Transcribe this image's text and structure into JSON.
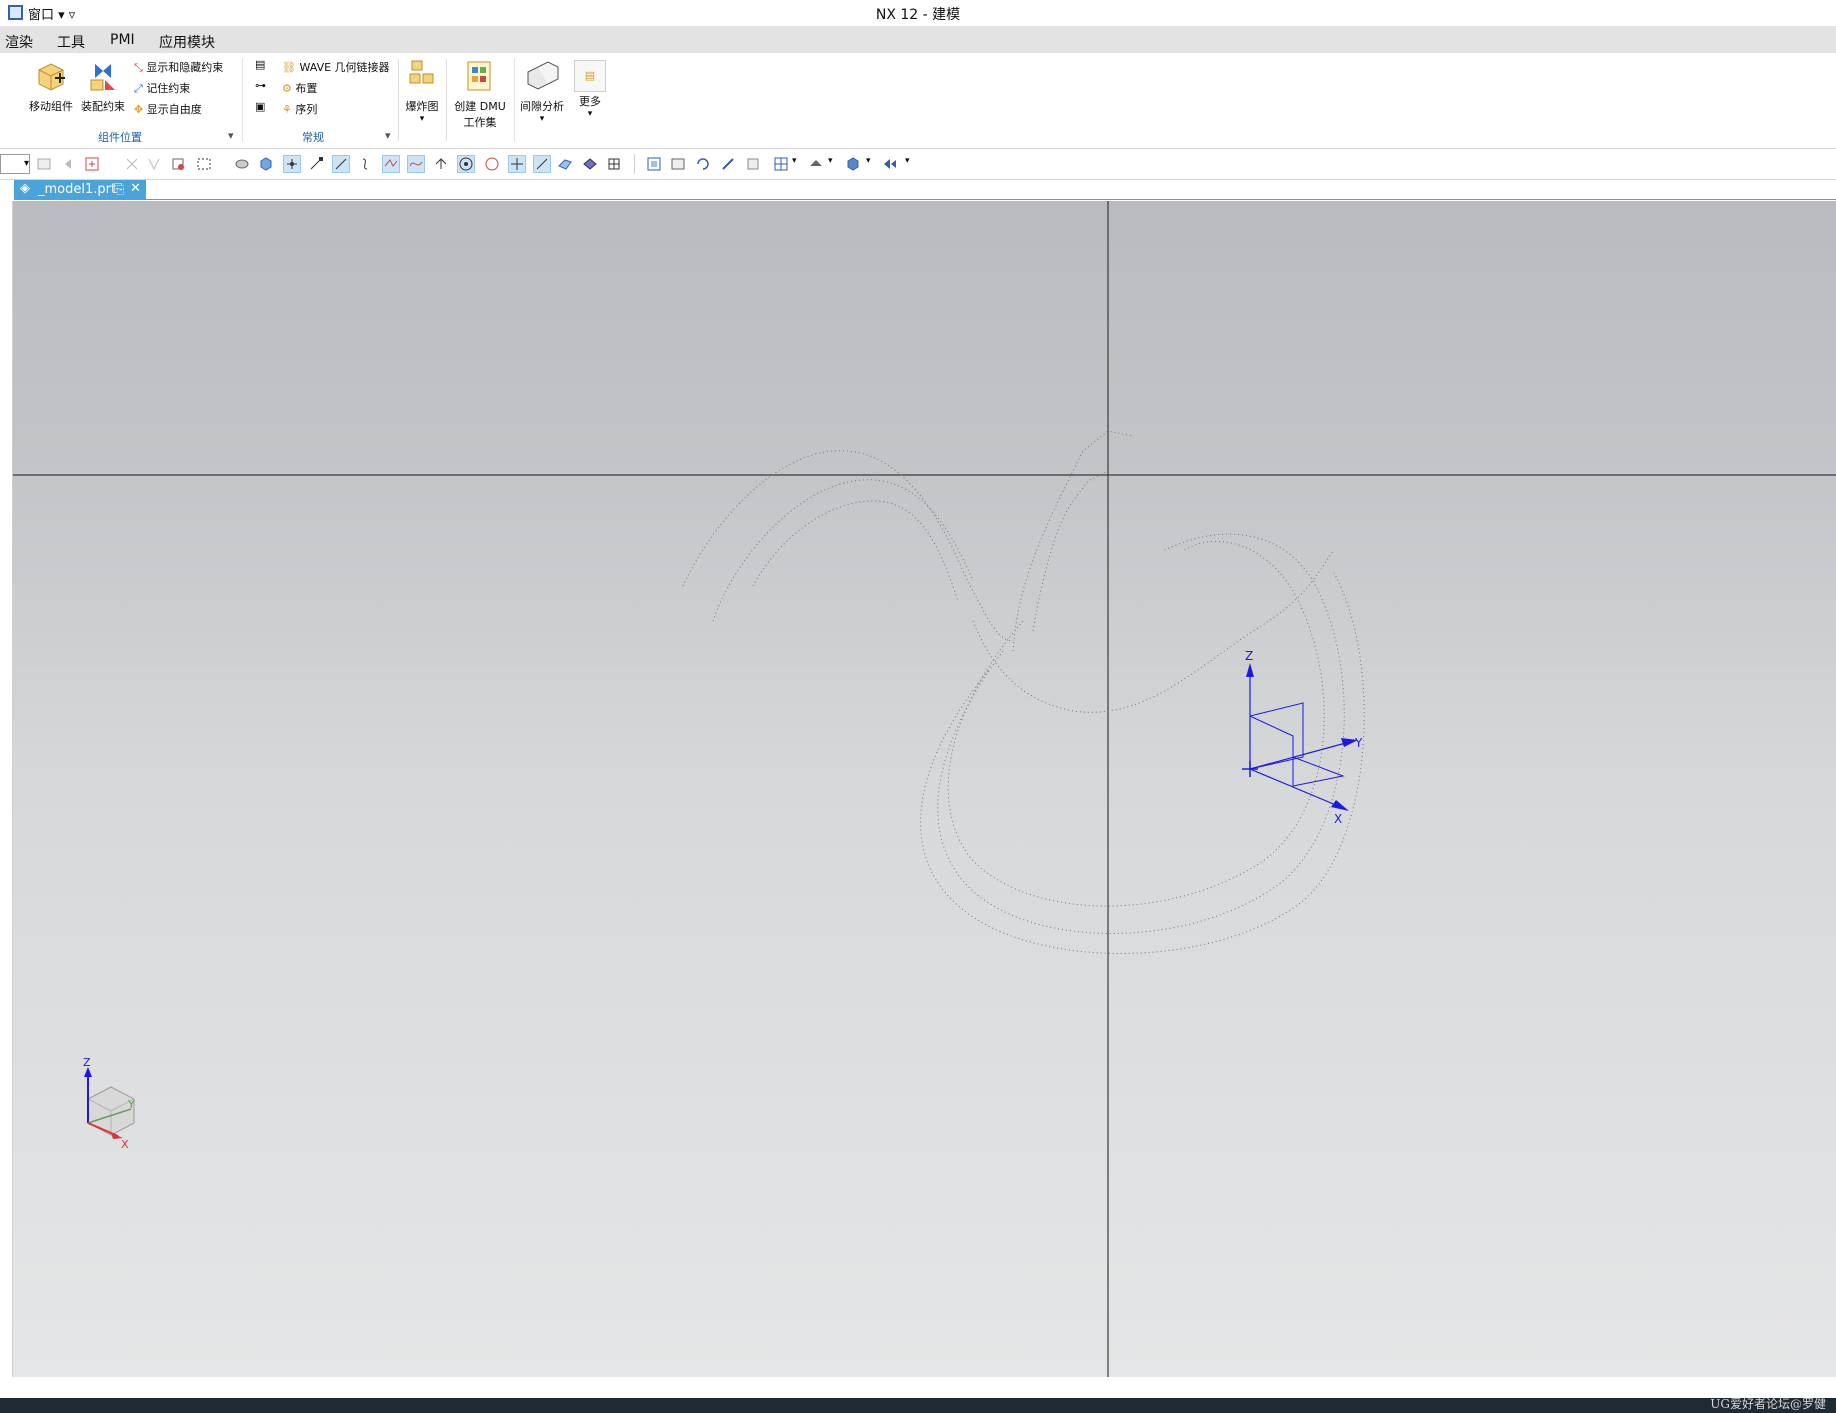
{
  "window": {
    "menu_label": "窗口 ▾ ▿",
    "title": "NX 12 - 建模"
  },
  "menubar": {
    "items": [
      "渲染",
      "工具",
      "PMI",
      "应用模块"
    ]
  },
  "ribbon": {
    "move_component": "移动组件",
    "assembly_constraint": "装配约束",
    "show_hide_constraints": "显示和隐藏约束",
    "remember_constraints": "记住约束",
    "show_dof": "显示自由度",
    "group_component_position": "组件位置",
    "wave_linker": "WAVE 几何链接器",
    "arrangement": "布置",
    "sequence": "序列",
    "group_general": "常规",
    "exploded_view": "爆炸图",
    "create_dmu_line1": "创建 DMU",
    "create_dmu_line2": "工作集",
    "clearance_analysis": "间隙分析",
    "more": "更多"
  },
  "tab": {
    "filename": "_model1.prt"
  },
  "triad": {
    "z": "Z",
    "y": "Y",
    "x": "X"
  },
  "mini_triad": {
    "z": "Z",
    "y": "Y",
    "x": "X"
  },
  "watermark": "UG爱好者论坛@罗健",
  "colors": {
    "title_bg": "#ffffff",
    "menubar_bg": "#e3e3e3",
    "group_label": "#1f5fa8",
    "tab_active": "#4aa3d9",
    "viewport_top": "#b9bbbf",
    "viewport_bottom": "#e5e6e7",
    "csys_blue": "#1b1be0",
    "taskbar": "#1f2a33"
  }
}
